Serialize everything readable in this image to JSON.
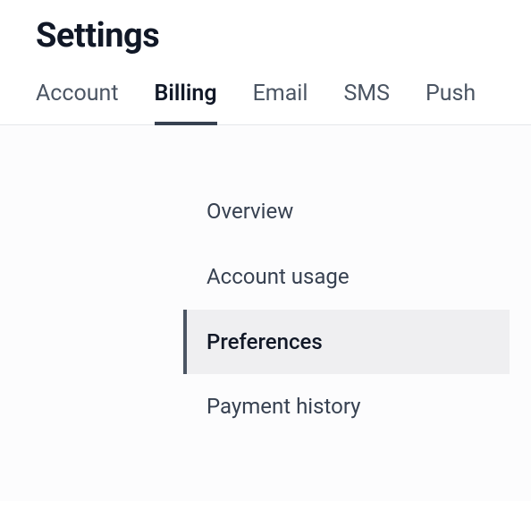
{
  "page": {
    "title": "Settings"
  },
  "tabs": [
    {
      "label": "Account",
      "active": false
    },
    {
      "label": "Billing",
      "active": true
    },
    {
      "label": "Email",
      "active": false
    },
    {
      "label": "SMS",
      "active": false
    },
    {
      "label": "Push",
      "active": false
    }
  ],
  "subnav": [
    {
      "label": "Overview",
      "active": false
    },
    {
      "label": "Account usage",
      "active": false
    },
    {
      "label": "Preferences",
      "active": true
    },
    {
      "label": "Payment history",
      "active": false
    }
  ]
}
